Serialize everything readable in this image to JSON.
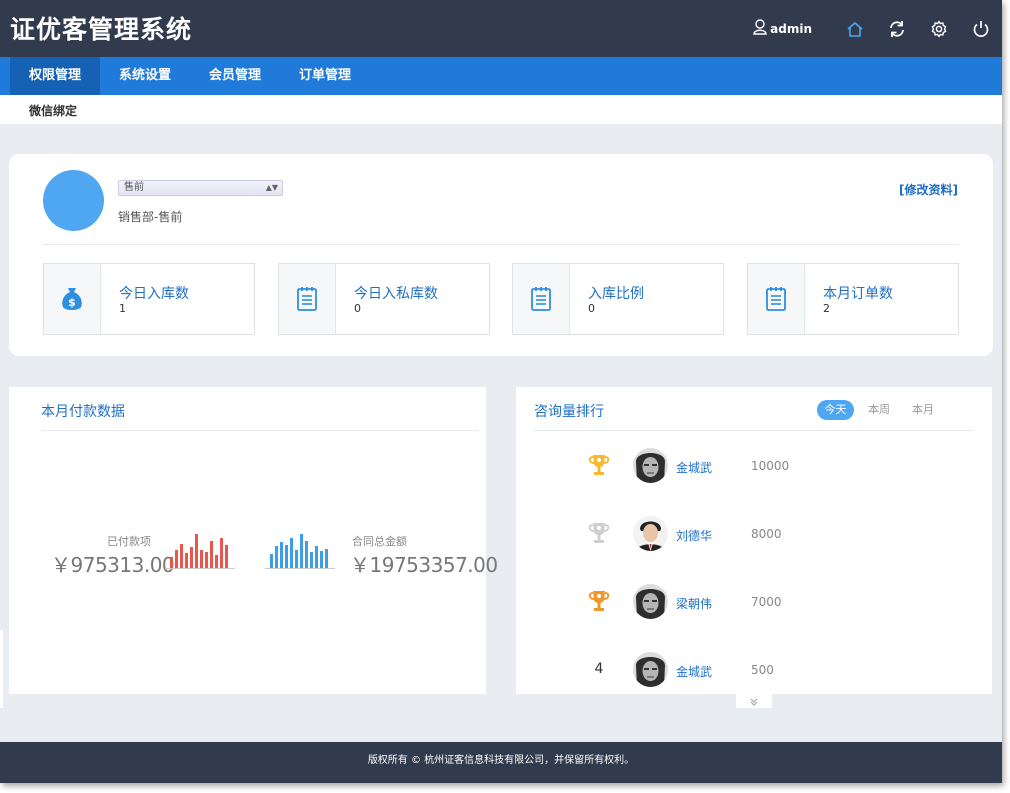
{
  "app": {
    "title": "证优客管理系统"
  },
  "header": {
    "username": "admin",
    "icons": [
      "user-icon",
      "home-icon",
      "refresh-icon",
      "gear-icon",
      "power-icon"
    ],
    "home_icon_color": "#4ea7f0"
  },
  "nav": {
    "tabs": [
      {
        "label": "权限管理",
        "active": true
      },
      {
        "label": "系统设置",
        "active": false
      },
      {
        "label": "会员管理",
        "active": false
      },
      {
        "label": "订单管理",
        "active": false
      }
    ],
    "subtabs": [
      {
        "label": "微信绑定"
      }
    ]
  },
  "profile": {
    "role_selected": "售前",
    "department": "销售部-售前",
    "edit_label": "[修改资料]"
  },
  "stats": [
    {
      "title": "今日入库数",
      "value": "1",
      "icon": "money-bag-icon"
    },
    {
      "title": "今日入私库数",
      "value": "0",
      "icon": "notepad-icon"
    },
    {
      "title": "入库比例",
      "value": "0",
      "icon": "notepad-icon"
    },
    {
      "title": "本月订单数",
      "value": "2",
      "icon": "notepad-icon"
    }
  ],
  "payments": {
    "title": "本月付款数据",
    "paid": {
      "label": "已付款项",
      "amount": "￥975313.00",
      "color": "#e8574e"
    },
    "contract": {
      "label": "合同总金额",
      "amount": "￥19753357.00",
      "color": "#3d9ee6"
    }
  },
  "ranking": {
    "title": "咨询量排行",
    "periods": [
      {
        "label": "今天",
        "active": true
      },
      {
        "label": "本周",
        "active": false
      },
      {
        "label": "本月",
        "active": false
      }
    ],
    "rows": [
      {
        "rank": "1",
        "medal": "gold-trophy-icon",
        "name": "金城武",
        "count": "10000"
      },
      {
        "rank": "2",
        "medal": "silver-trophy-icon",
        "name": "刘德华",
        "count": "8000"
      },
      {
        "rank": "3",
        "medal": "bronze-trophy-icon",
        "name": "梁朝伟",
        "count": "7000"
      },
      {
        "rank": "4",
        "medal": "",
        "name": "金城武",
        "count": "500"
      }
    ],
    "medal_colors": {
      "gold": "#f5b82e",
      "silver": "#cfcfcf",
      "bronze": "#f0972a"
    }
  },
  "footer": {
    "text": "版权所有 © 杭州证客信息科技有限公司，并保留所有权利。"
  }
}
